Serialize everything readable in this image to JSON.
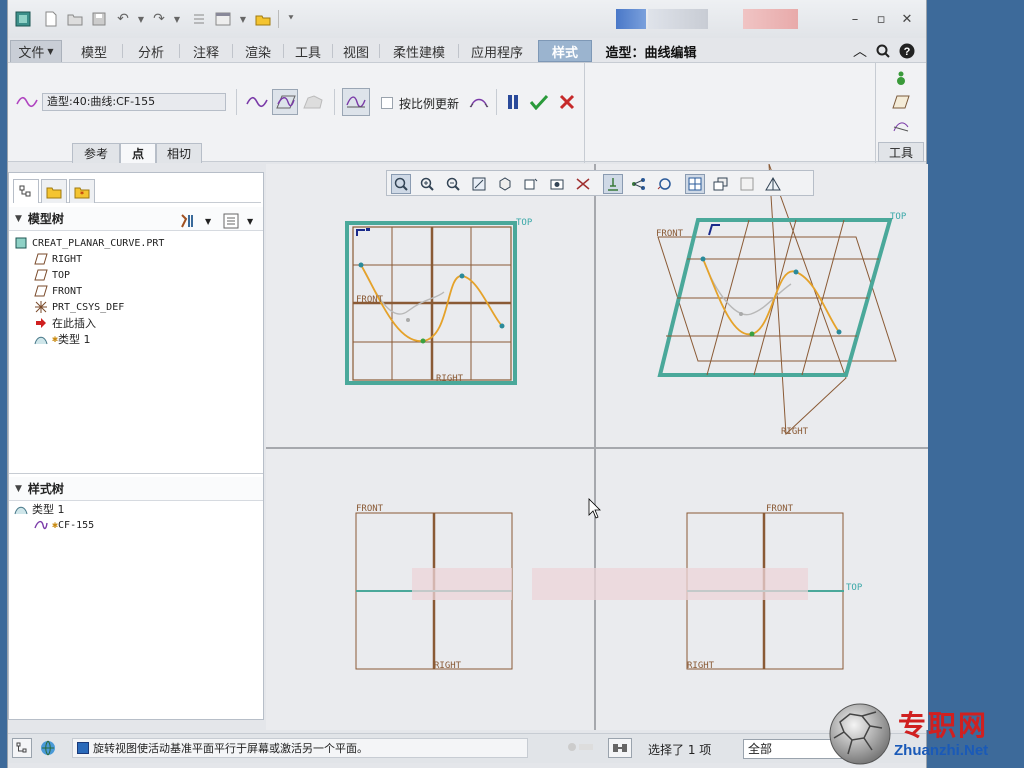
{
  "tabs": {
    "file": "文件",
    "items": [
      "模型",
      "分析",
      "注释",
      "渲染",
      "工具",
      "视图",
      "柔性建模",
      "应用程序"
    ],
    "active": "样式",
    "context": "造型：曲线编辑"
  },
  "ribbon": {
    "curve_name": "造型:40:曲线:CF-155",
    "proportional_update": "按比例更新",
    "subtabs": [
      "参考",
      "点",
      "相切"
    ],
    "tools_label": "工具"
  },
  "left_panel": {
    "model_tree_title": "模型树",
    "model_tree": [
      {
        "icon": "part-icon",
        "label": "CREAT_PLANAR_CURVE.PRT"
      },
      {
        "icon": "datum-plane-icon",
        "label": "RIGHT"
      },
      {
        "icon": "datum-plane-icon",
        "label": "TOP"
      },
      {
        "icon": "datum-plane-icon",
        "label": "FRONT"
      },
      {
        "icon": "csys-icon",
        "label": "PRT_CSYS_DEF"
      },
      {
        "icon": "insert-here-icon",
        "label": "在此插入"
      },
      {
        "icon": "style-feature-icon",
        "label": "类型 1"
      }
    ],
    "style_tree_title": "样式树",
    "style_tree": [
      {
        "icon": "style-feature-icon",
        "label": "类型 1"
      },
      {
        "icon": "curve-icon",
        "label": "CF-155"
      }
    ]
  },
  "viewports": {
    "plane_labels": {
      "top": "TOP",
      "front": "FRONT",
      "right": "RIGHT"
    }
  },
  "status": {
    "message": "旋转视图使活动基准平面平行于屏幕或激活另一个平面。",
    "selection": "选择了 1 项",
    "filter": "全部"
  },
  "watermark": {
    "text": "专职网",
    "url": "Zhuanzhi.Net"
  },
  "colors": {
    "accent_tab": "#9bb4cf",
    "grid": "#8a5a35",
    "active_plane": "#4aa89a",
    "curve": "#e5a22a",
    "curve_ghost": "#b8b8b8",
    "accept_green": "#2a9a3a",
    "cancel_red": "#c62a2a",
    "pause_blue": "#2a4a9a"
  }
}
